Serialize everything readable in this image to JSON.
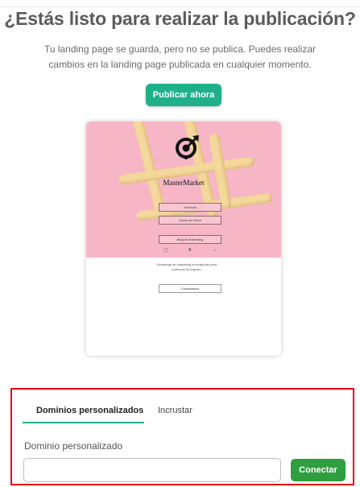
{
  "page": {
    "heading": "¿Estás listo para realizar la publicación?",
    "description": "Tu landing page se guarda, pero no se publica. Puedes realizar cambios en la landing page publicada en cualquier momento.",
    "publish_button": "Publicar ahora"
  },
  "preview": {
    "brand_name": "MasterMarket",
    "buttons": [
      "Servicios",
      "Curso de Zoom",
      "Blog de Marketing"
    ],
    "social_icons": [
      "instagram-icon",
      "x-icon",
      "tiktok-icon"
    ],
    "social_x_label": "X",
    "description": "Estrategia de marketing innovadoras para potenciar tu negocio.",
    "contact_button": "Contactanos",
    "hero_color": "#f7b6c6"
  },
  "panel": {
    "tabs": [
      {
        "label": "Dominios personalizados",
        "active": true
      },
      {
        "label": "Incrustar",
        "active": false
      }
    ],
    "field_label": "Dominio personalizado",
    "input_value": "",
    "input_placeholder": "",
    "connect_button": "Conectar",
    "accent_color": "#1fb08a",
    "highlight_color": "#e5000f"
  }
}
